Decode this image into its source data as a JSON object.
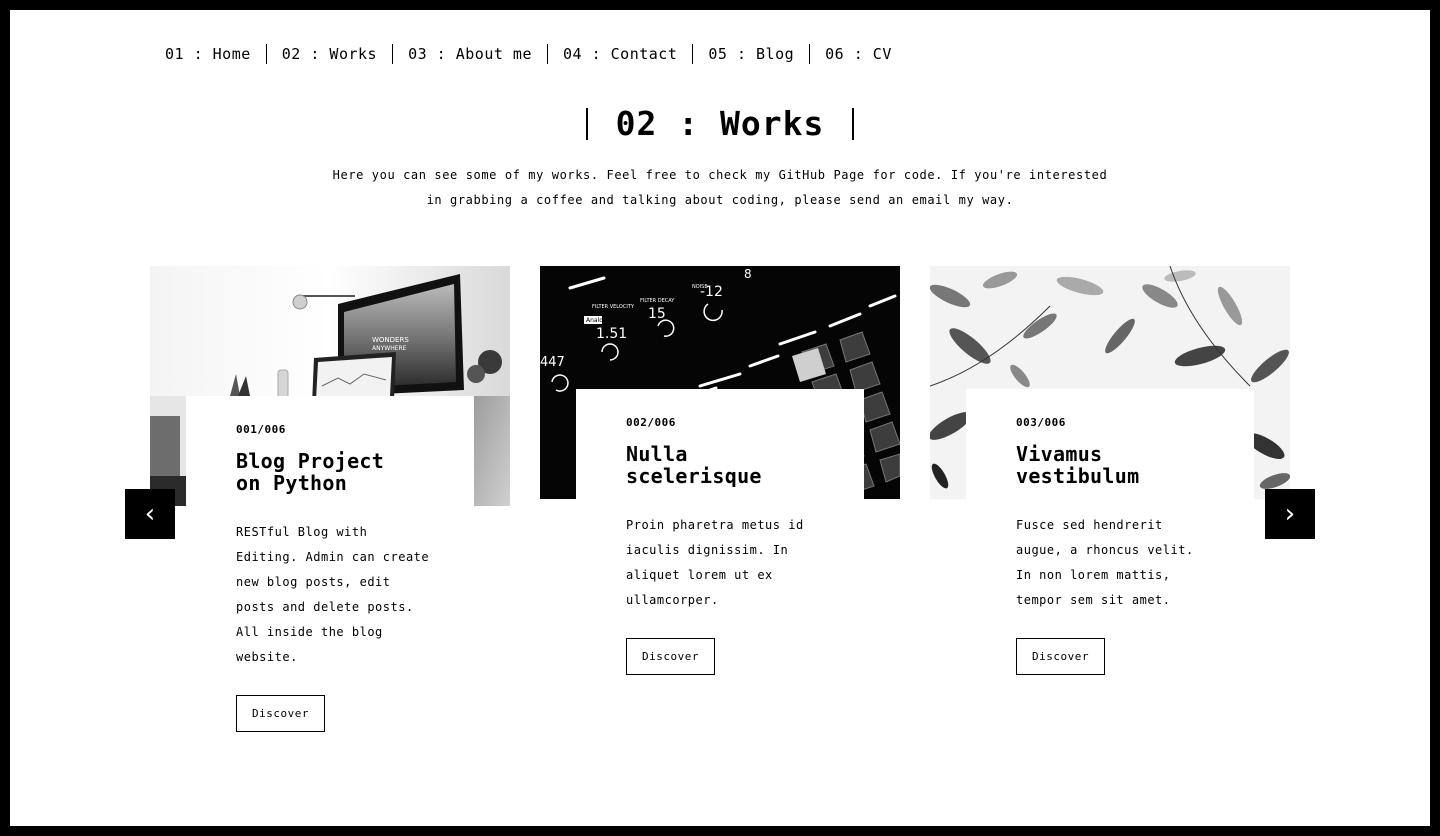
{
  "nav": {
    "items": [
      {
        "label": "01 : Home"
      },
      {
        "label": "02 : Works"
      },
      {
        "label": "03 : About me"
      },
      {
        "label": "04 : Contact"
      },
      {
        "label": "05 : Blog"
      },
      {
        "label": "06 : CV"
      }
    ]
  },
  "section": {
    "title": "02 : Works",
    "intro_line1": "Here you can see some of my works. Feel free to check my GitHub Page for code. If you're interested",
    "intro_line2": "in grabbing a coffee and talking about coding, please send an email my way."
  },
  "carousel": {
    "prev_icon": "‹",
    "next_icon": "›",
    "cards": [
      {
        "number": "001/006",
        "title_line1": "Blog Project",
        "title_line2": "on Python",
        "desc": "RESTful Blog with Editing. Admin can create new blog posts, edit posts and delete posts. All inside the blog website.",
        "button": "Discover",
        "image_icon": "desk-monitor-image",
        "image_text_1": "WONDERS",
        "image_text_2": "ANYWHERE"
      },
      {
        "number": "002/006",
        "title_line1": "Nulla",
        "title_line2": "scelerisque",
        "desc": "Proin pharetra metus id iaculis dignissim. In aliquet lorem ut ex ullamcorper.",
        "button": "Discover",
        "image_icon": "synth-controller-image",
        "image_text_1": "Analog",
        "image_text_2": "FILTER VELOCITY",
        "image_text_3": "FILTER DECAY",
        "image_text_4": "NOISE",
        "image_text_5": "1.51",
        "image_text_6": "15",
        "image_text_7": "-12",
        "image_text_8": "8",
        "image_text_9": "447"
      },
      {
        "number": "003/006",
        "title_line1": "Vivamus",
        "title_line2": "vestibulum",
        "desc": "Fusce sed hendrerit augue, a rhoncus velit. In non lorem mattis, tempor sem sit amet.",
        "button": "Discover",
        "image_icon": "leaves-image"
      }
    ]
  },
  "colors": {
    "background": "#ffffff",
    "frame": "#000000",
    "text": "#000000"
  }
}
